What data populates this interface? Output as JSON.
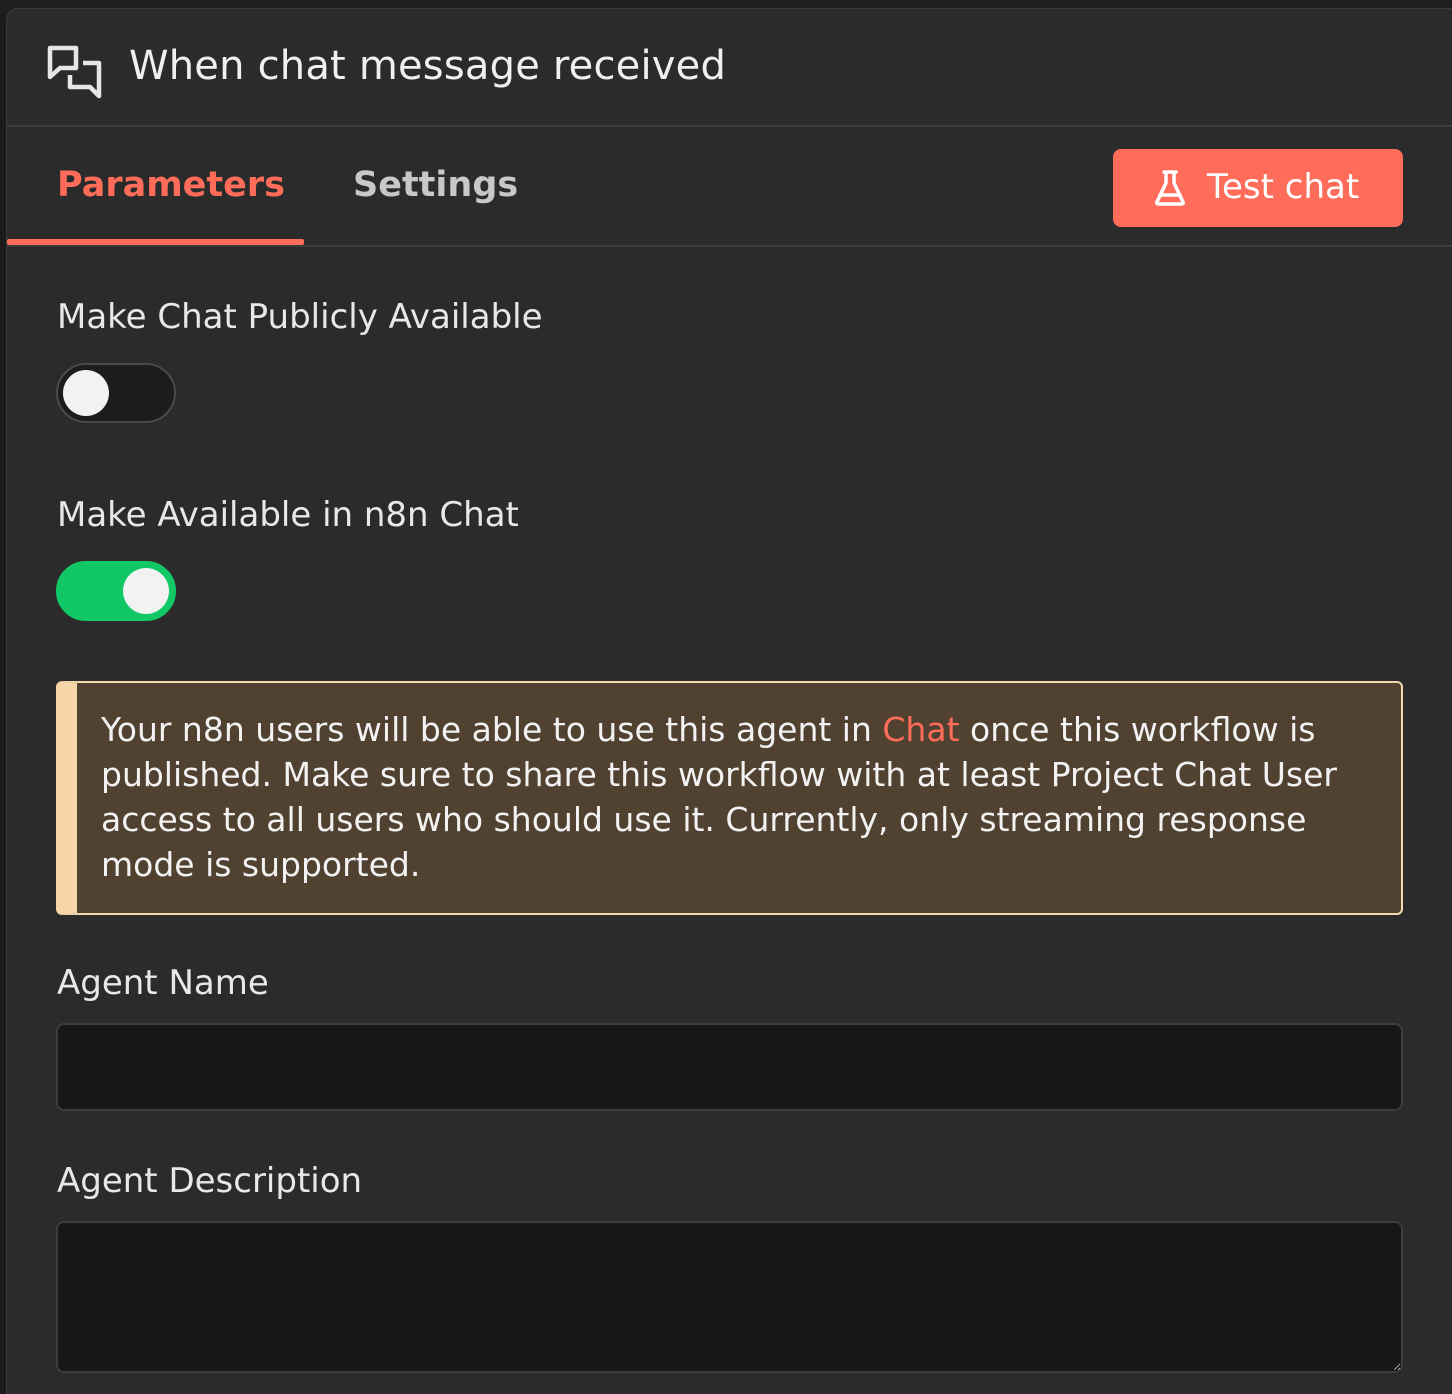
{
  "header": {
    "title": "When chat message received",
    "icon": "chat-bubbles-icon"
  },
  "tabs": [
    {
      "label": "Parameters",
      "active": true
    },
    {
      "label": "Settings",
      "active": false
    }
  ],
  "test_button": {
    "label": "Test chat",
    "icon": "flask-icon"
  },
  "params": {
    "public_chat": {
      "label": "Make Chat Publicly Available",
      "enabled": false
    },
    "n8n_chat": {
      "label": "Make Available in n8n Chat",
      "enabled": true
    },
    "notice": {
      "before": "Your n8n users will be able to use this agent in ",
      "link": "Chat",
      "after": " once this workflow is published. Make sure to share this workflow with at least Project Chat User access to all users who should use it. Currently, only streaming response mode is supported."
    },
    "agent_name": {
      "label": "Agent Name",
      "value": ""
    },
    "agent_description": {
      "label": "Agent Description",
      "value": ""
    }
  },
  "colors": {
    "accent": "#ff6d5a",
    "toggle_on": "#12c765",
    "panel_bg": "#2b2b2b",
    "notice_bg": "#514131",
    "notice_border": "#f6d5a8"
  }
}
